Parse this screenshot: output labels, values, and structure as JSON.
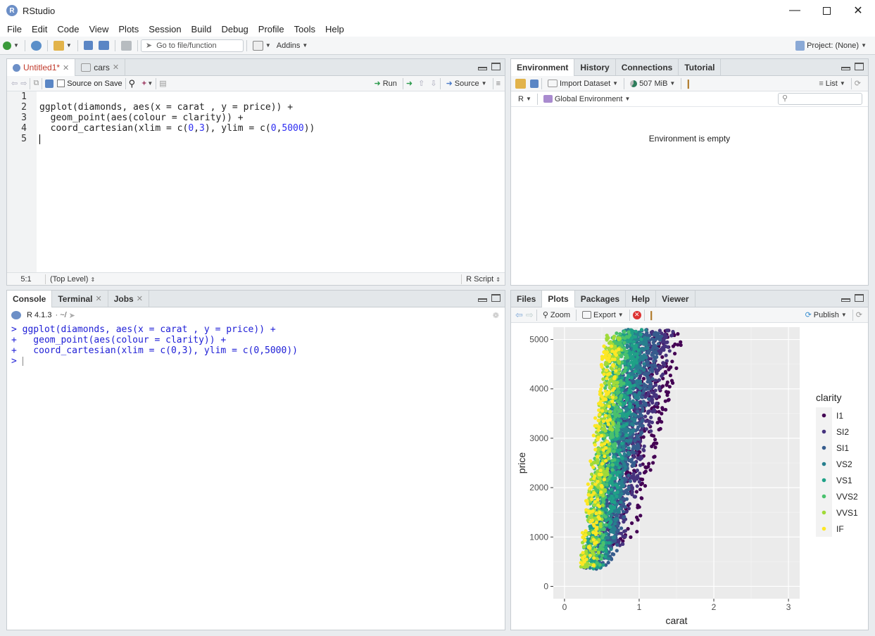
{
  "window": {
    "title": "RStudio",
    "app_icon": "R",
    "controls": [
      "minimize-icon",
      "maximize-icon",
      "close-icon"
    ]
  },
  "menu": [
    "File",
    "Edit",
    "Code",
    "View",
    "Plots",
    "Session",
    "Build",
    "Debug",
    "Profile",
    "Tools",
    "Help"
  ],
  "toolbar": {
    "goto_placeholder": "Go to file/function",
    "addins": "Addins",
    "project": "Project: (None)"
  },
  "source": {
    "tabs": [
      {
        "label": "Untitled1*",
        "active": true
      },
      {
        "label": "cars",
        "active": false
      }
    ],
    "source_on_save": "Source on Save",
    "run": "Run",
    "source_btn": "Source",
    "line_numbers": [
      "1",
      "2",
      "3",
      "4",
      "5"
    ],
    "code": [
      {
        "text": "ggplot(diamonds, aes(x = carat , y = price)) +"
      },
      {
        "pre": "  geom_point(aes(colour = clarity)) +"
      },
      {
        "pre": "  coord_cartesian(xlim = c(",
        "n1": "0",
        ",": ",",
        "n2": "3",
        "mid": "), ylim = c(",
        "n3": "0",
        ",2": ",",
        "n4": "5000",
        "post": "))"
      }
    ],
    "status_pos": "5:1",
    "status_scope": "(Top Level)",
    "status_type": "R Script"
  },
  "environment": {
    "tabs": [
      "Environment",
      "History",
      "Connections",
      "Tutorial"
    ],
    "import_dataset": "Import Dataset",
    "memory": "507 MiB",
    "view_mode": "List",
    "language": "R",
    "scope": "Global Environment",
    "empty_message": "Environment is empty"
  },
  "console": {
    "tabs": [
      "Console",
      "Terminal",
      "Jobs"
    ],
    "r_version": "R 4.1.3",
    "path": "· ~/",
    "lines": [
      "> ggplot(diamonds, aes(x = carat , y = price)) +",
      "+   geom_point(aes(colour = clarity)) +",
      "+   coord_cartesian(xlim = c(0,3), ylim = c(0,5000))",
      "> "
    ]
  },
  "files": {
    "tabs": [
      "Files",
      "Plots",
      "Packages",
      "Help",
      "Viewer"
    ],
    "zoom": "Zoom",
    "export": "Export",
    "publish": "Publish"
  },
  "chart_data": {
    "type": "scatter",
    "title": "",
    "xlabel": "carat",
    "ylabel": "price",
    "xlim": [
      -0.15,
      3.15
    ],
    "ylim": [
      -250,
      5250
    ],
    "x_ticks": [
      "0",
      "1",
      "2",
      "3"
    ],
    "y_ticks": [
      "0",
      "1000",
      "2000",
      "3000",
      "4000",
      "5000"
    ],
    "grid": true,
    "legend_position": "right",
    "legend_title": "clarity",
    "series": [
      {
        "name": "I1",
        "color": "#440154"
      },
      {
        "name": "SI2",
        "color": "#46337E"
      },
      {
        "name": "SI1",
        "color": "#365C8D"
      },
      {
        "name": "VS2",
        "color": "#277F8E"
      },
      {
        "name": "VS1",
        "color": "#1FA187"
      },
      {
        "name": "VVS2",
        "color": "#4AC16D"
      },
      {
        "name": "VVS1",
        "color": "#A0DA39"
      },
      {
        "name": "IF",
        "color": "#FDE725"
      }
    ],
    "clusters": [
      {
        "series": "I1",
        "x": [
          0.55,
          1.55
        ],
        "y": [
          800,
          5200
        ],
        "n": 260
      },
      {
        "series": "SI2",
        "x": [
          0.4,
          1.4
        ],
        "y": [
          600,
          5200
        ],
        "n": 480
      },
      {
        "series": "SI1",
        "x": [
          0.3,
          1.25
        ],
        "y": [
          350,
          5200
        ],
        "n": 600
      },
      {
        "series": "VS2",
        "x": [
          0.3,
          1.1
        ],
        "y": [
          350,
          5200
        ],
        "n": 520
      },
      {
        "series": "VS1",
        "x": [
          0.28,
          1.0
        ],
        "y": [
          350,
          5200
        ],
        "n": 420
      },
      {
        "series": "VVS2",
        "x": [
          0.26,
          0.85
        ],
        "y": [
          350,
          5200
        ],
        "n": 340
      },
      {
        "series": "VVS1",
        "x": [
          0.24,
          0.75
        ],
        "y": [
          350,
          5100
        ],
        "n": 280
      },
      {
        "series": "IF",
        "x": [
          0.22,
          0.7
        ],
        "y": [
          350,
          4900
        ],
        "n": 160
      }
    ]
  }
}
